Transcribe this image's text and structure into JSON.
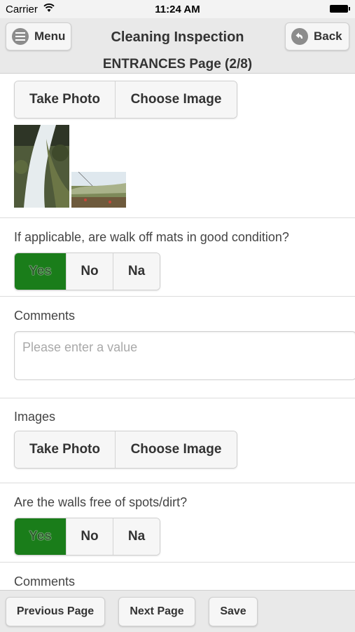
{
  "status_bar": {
    "carrier": "Carrier",
    "time": "11:24 AM"
  },
  "header": {
    "menu_label": "Menu",
    "title": "Cleaning Inspection",
    "back_label": "Back",
    "subtitle": "ENTRANCES Page (2/8)"
  },
  "sections": {
    "images_top": {
      "take_photo": "Take Photo",
      "choose_image": "Choose Image",
      "thumbnails": [
        "waterfall-photo",
        "landscape-photo"
      ]
    },
    "q_walk_off_mats": {
      "question": "If applicable, are walk off mats in good condition?",
      "options": [
        "Yes",
        "No",
        "Na"
      ],
      "selected": "Yes"
    },
    "comments_1": {
      "label": "Comments",
      "placeholder": "Please enter a value"
    },
    "images_2": {
      "label": "Images",
      "take_photo": "Take Photo",
      "choose_image": "Choose Image"
    },
    "q_walls": {
      "question": "Are the walls free of spots/dirt?",
      "options": [
        "Yes",
        "No",
        "Na"
      ],
      "selected": "Yes"
    },
    "comments_2": {
      "label": "Comments"
    }
  },
  "footer": {
    "previous": "Previous Page",
    "next": "Next Page",
    "save": "Save"
  },
  "colors": {
    "selected_green": "#1a7d1a",
    "bar_bg": "#e9e9e9"
  }
}
